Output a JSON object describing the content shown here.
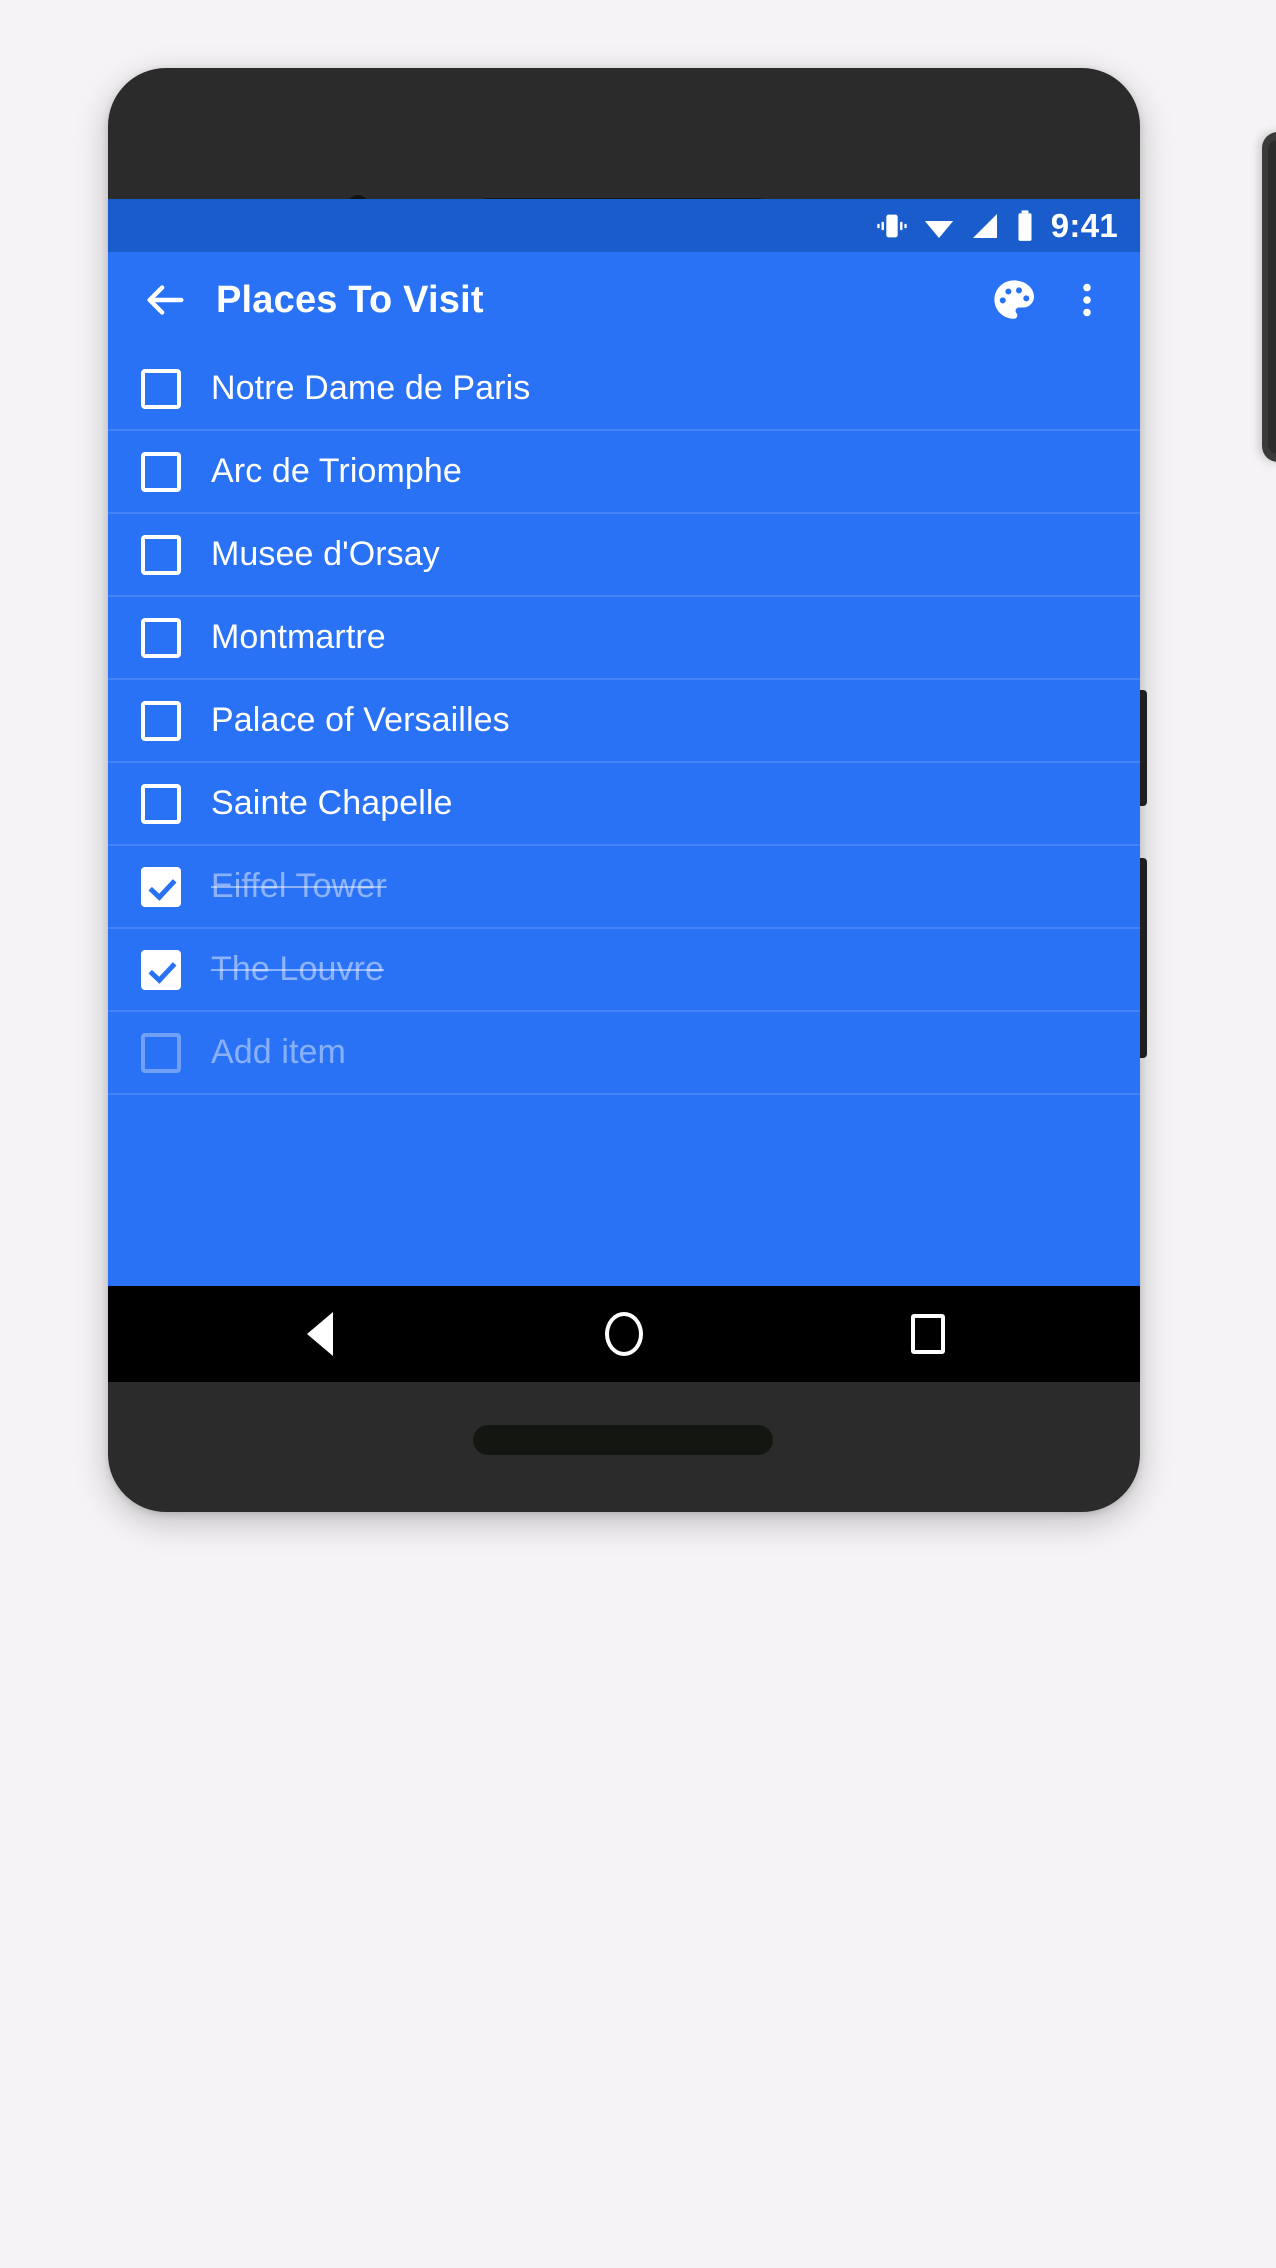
{
  "status_bar": {
    "clock": "9:41",
    "icons": [
      "vibrate-icon",
      "wifi-icon",
      "cellular-signal-icon",
      "battery-icon"
    ]
  },
  "app_bar": {
    "title": "Places To Visit",
    "back_icon": "back-arrow-icon",
    "theme_icon": "palette-icon",
    "overflow_icon": "overflow-menu-icon"
  },
  "list": {
    "items": [
      {
        "label": "Notre Dame de Paris",
        "checked": false
      },
      {
        "label": "Arc de Triomphe",
        "checked": false
      },
      {
        "label": "Musee d'Orsay",
        "checked": false
      },
      {
        "label": "Montmartre",
        "checked": false
      },
      {
        "label": "Palace of Versailles",
        "checked": false
      },
      {
        "label": "Sainte Chapelle",
        "checked": false
      },
      {
        "label": "Eiffel Tower",
        "checked": true
      },
      {
        "label": "The Louvre",
        "checked": true
      }
    ],
    "add_item_placeholder": "Add item"
  },
  "nav_bar": {
    "back": "nav-back-icon",
    "home": "nav-home-icon",
    "recents": "nav-recents-icon"
  },
  "colors": {
    "app_background": "#2a72f5",
    "status_bar": "#1b5ccd",
    "accent_white": "#ffffff",
    "nav_bar": "#000000",
    "device_body": "#2b2b2b",
    "page_background": "#f5f3f5"
  }
}
